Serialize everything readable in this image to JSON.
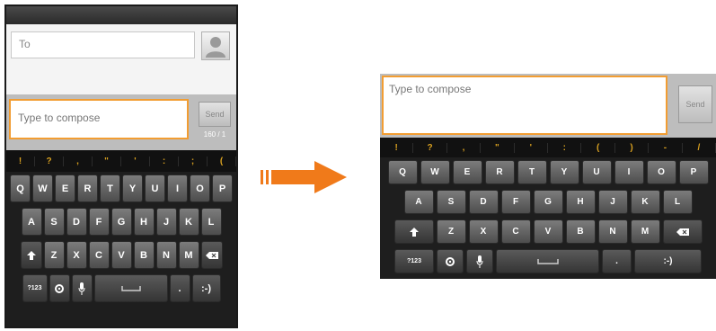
{
  "before": {
    "to_placeholder": "To",
    "compose_placeholder": "Type to compose",
    "send_label": "Send",
    "char_counter": "160 / 1",
    "symbols": [
      "!",
      "?",
      ",",
      "\"",
      "'",
      ":",
      ";",
      "("
    ],
    "row1": [
      "Q",
      "W",
      "E",
      "R",
      "T",
      "Y",
      "U",
      "I",
      "O",
      "P"
    ],
    "row2": [
      "A",
      "S",
      "D",
      "F",
      "G",
      "H",
      "J",
      "K",
      "L"
    ],
    "row3": [
      "Z",
      "X",
      "C",
      "V",
      "B",
      "N",
      "M"
    ],
    "key_123": "?123",
    "key_smile": ":-)"
  },
  "after": {
    "compose_placeholder": "Type to compose",
    "send_label": "Send",
    "symbols": [
      "!",
      "?",
      ",",
      "\"",
      "'",
      ":",
      "(",
      ")",
      "-",
      "/"
    ],
    "row1": [
      "Q",
      "W",
      "E",
      "R",
      "T",
      "Y",
      "U",
      "I",
      "O",
      "P"
    ],
    "row2": [
      "A",
      "S",
      "D",
      "F",
      "G",
      "H",
      "J",
      "K",
      "L"
    ],
    "row3": [
      "Z",
      "X",
      "C",
      "V",
      "B",
      "N",
      "M"
    ],
    "key_123": "?123",
    "key_smile": ":-)"
  },
  "colors": {
    "accent_orange": "#f29d32",
    "arrow_orange": "#f07a1a",
    "symbol_gold": "#d8a020"
  },
  "icons": [
    "contact-icon",
    "shift-icon",
    "delete-icon",
    "gear-icon",
    "mic-icon",
    "space-icon",
    "arrow-right-icon"
  ]
}
